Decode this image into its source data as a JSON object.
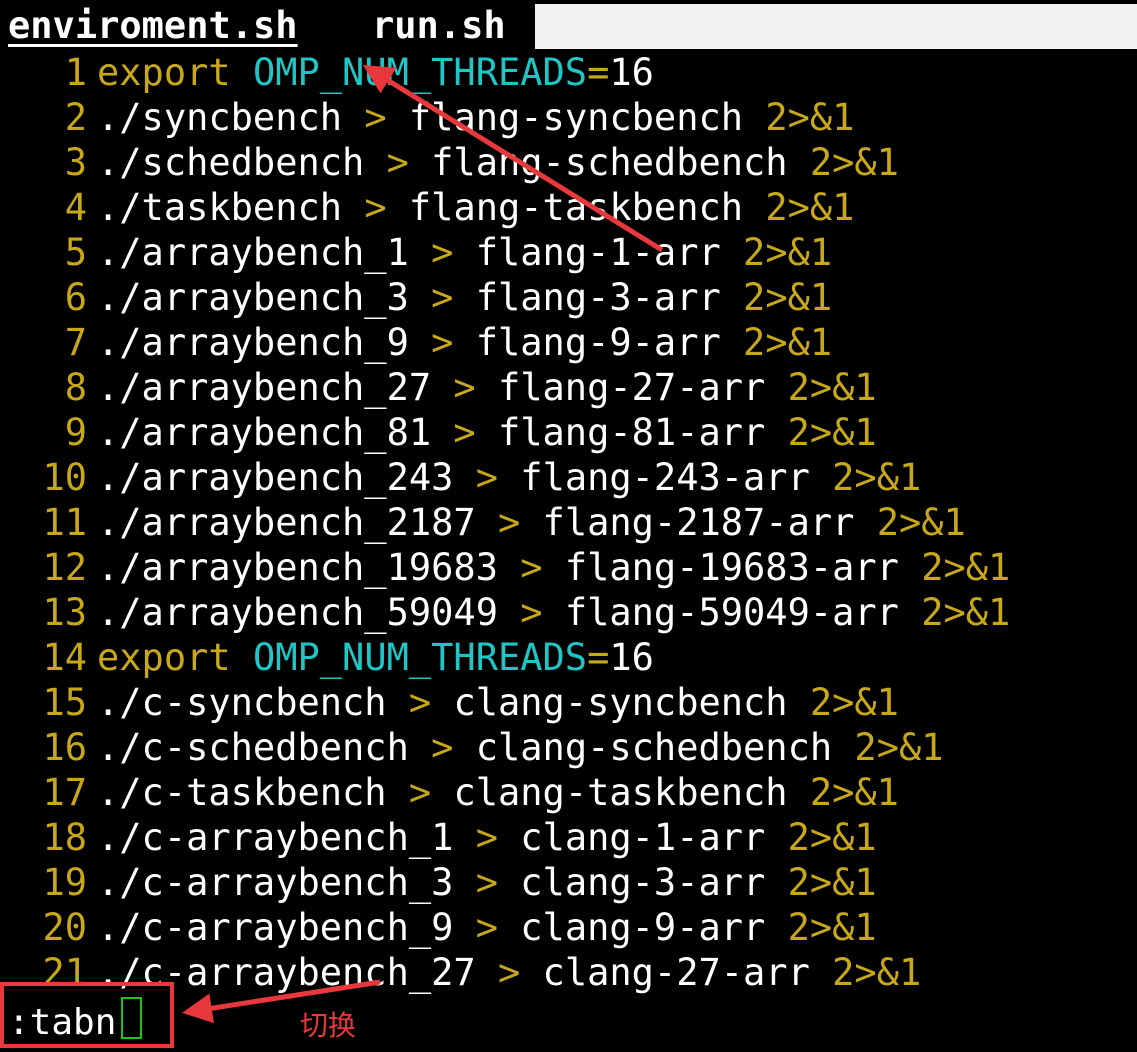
{
  "tabs": [
    {
      "label": "enviroment.sh",
      "active": true
    },
    {
      "label": "run.sh",
      "active": false
    }
  ],
  "lines": [
    {
      "n": "1",
      "kind": "export",
      "kw": "export",
      "var": "OMP_NUM_THREADS",
      "eq": "=",
      "val": "16"
    },
    {
      "n": "2",
      "kind": "cmd",
      "cmd": "./syncbench",
      "out": "flang-syncbench"
    },
    {
      "n": "3",
      "kind": "cmd",
      "cmd": "./schedbench",
      "out": "flang-schedbench"
    },
    {
      "n": "4",
      "kind": "cmd",
      "cmd": "./taskbench",
      "out": "flang-taskbench"
    },
    {
      "n": "5",
      "kind": "cmd",
      "cmd": "./arraybench_1",
      "out": "flang-1-arr"
    },
    {
      "n": "6",
      "kind": "cmd",
      "cmd": "./arraybench_3",
      "out": "flang-3-arr"
    },
    {
      "n": "7",
      "kind": "cmd",
      "cmd": "./arraybench_9",
      "out": "flang-9-arr"
    },
    {
      "n": "8",
      "kind": "cmd",
      "cmd": "./arraybench_27",
      "out": "flang-27-arr"
    },
    {
      "n": "9",
      "kind": "cmd",
      "cmd": "./arraybench_81",
      "out": "flang-81-arr"
    },
    {
      "n": "10",
      "kind": "cmd",
      "cmd": "./arraybench_243",
      "out": "flang-243-arr"
    },
    {
      "n": "11",
      "kind": "cmd",
      "cmd": "./arraybench_2187",
      "out": "flang-2187-arr"
    },
    {
      "n": "12",
      "kind": "cmd",
      "cmd": "./arraybench_19683",
      "out": "flang-19683-arr"
    },
    {
      "n": "13",
      "kind": "cmd",
      "cmd": "./arraybench_59049",
      "out": "flang-59049-arr"
    },
    {
      "n": "14",
      "kind": "export",
      "kw": "export",
      "var": "OMP_NUM_THREADS",
      "eq": "=",
      "val": "16"
    },
    {
      "n": "15",
      "kind": "cmd",
      "cmd": "./c-syncbench",
      "out": "clang-syncbench"
    },
    {
      "n": "16",
      "kind": "cmd",
      "cmd": "./c-schedbench",
      "out": "clang-schedbench"
    },
    {
      "n": "17",
      "kind": "cmd",
      "cmd": "./c-taskbench",
      "out": "clang-taskbench"
    },
    {
      "n": "18",
      "kind": "cmd",
      "cmd": "./c-arraybench_1",
      "out": "clang-1-arr"
    },
    {
      "n": "19",
      "kind": "cmd",
      "cmd": "./c-arraybench_3",
      "out": "clang-3-arr"
    },
    {
      "n": "20",
      "kind": "cmd",
      "cmd": "./c-arraybench_9",
      "out": "clang-9-arr"
    },
    {
      "n": "21",
      "kind": "cmd",
      "cmd": "./c-arraybench_27",
      "out": "clang-27-arr"
    }
  ],
  "syntax": {
    "gt": ">",
    "redir": "2>&1"
  },
  "command_line": ":tabn",
  "annotation": "切换",
  "colors": {
    "keyword": "#c8a818",
    "variable": "#1fc6c6",
    "annotation": "#e8383c",
    "cursor": "#1ec21e"
  }
}
